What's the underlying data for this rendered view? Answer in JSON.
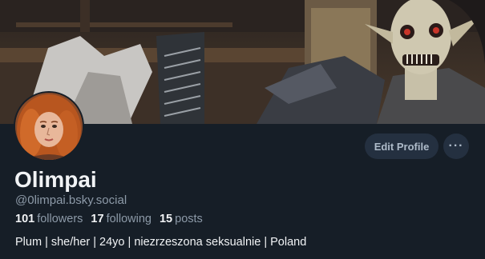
{
  "profile": {
    "display_name": "Olimpai",
    "handle": "@0limpai.bsky.social",
    "bio": "Plum | she/her | 24yo | niezrzeszona seksualnie | Poland"
  },
  "stats": {
    "followers_count": "101",
    "followers_label": "followers",
    "following_count": "17",
    "following_label": "following",
    "posts_count": "15",
    "posts_label": "posts"
  },
  "actions": {
    "edit_profile_label": "Edit Profile",
    "more_label": "···"
  },
  "colors": {
    "background": "#161e27",
    "button_bg": "#243040",
    "text_primary": "#f1f3f5",
    "text_secondary": "#8d9aa8"
  },
  "icons": {
    "more": "more-horizontal-icon"
  }
}
